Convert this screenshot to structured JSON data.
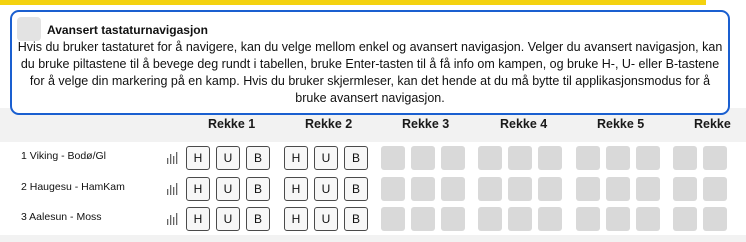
{
  "accessibility_panel": {
    "title": "Avansert tastaturnavigasjon",
    "body": "Hvis du bruker tastaturet for å navigere, kan du velge mellom enkel og avansert navigasjon. Velger du avansert navigasjon, kan du bruke piltastene til å bevege deg rundt i tabellen, bruke Enter-tasten til å få info om kampen, og bruke H-, U- eller B-tastene for å velge din markering på en kamp. Hvis du bruker skjermleser, kan det hende at du må bytte til applikasjonsmodus for å bruke avansert navigasjon."
  },
  "rekke_headers": [
    "Rekke 1",
    "Rekke 2",
    "Rekke 3",
    "Rekke 4",
    "Rekke 5",
    "Rekke"
  ],
  "outcome_labels": [
    "H",
    "U",
    "B"
  ],
  "matches": [
    {
      "label": "1  Viking - Bodø/Gl"
    },
    {
      "label": "2  Haugesu - HamKam"
    },
    {
      "label": "3  Aalesun - Moss"
    }
  ],
  "colors": {
    "accent_border": "#1a5fd0",
    "top_bar": "#f4d20f",
    "inactive_cell": "#d9d9d9"
  },
  "icons": {
    "stats": "bar-chart-icon",
    "toggle": "checkbox-icon"
  }
}
